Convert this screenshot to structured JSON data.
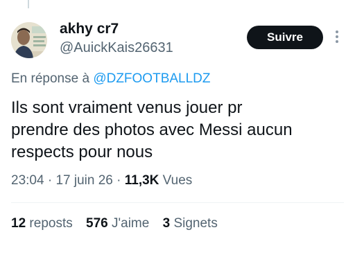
{
  "author": {
    "display_name": "akhy cr7",
    "handle": "@AuickKais26631"
  },
  "follow_button": {
    "label": "Suivre"
  },
  "reply_to": {
    "prefix": "En réponse à",
    "mention": "@DZFOOTBALLDZ"
  },
  "tweet": {
    "lines": [
      "Ils sont vraiment venus jouer pr",
      "prendre des photos avec Messi aucun",
      "respects pour nous"
    ]
  },
  "meta": {
    "time": "23:04",
    "separator": "·",
    "date": "17 juin 26",
    "views_count": "11,3K",
    "views_label": "Vues"
  },
  "stats": {
    "reposts_count": "12",
    "reposts_label": "reposts",
    "likes_count": "576",
    "likes_label": "J'aime",
    "bookmarks_count": "3",
    "bookmarks_label": "Signets"
  },
  "icons": {
    "more": "more-options-icon",
    "avatar": "profile-photo"
  },
  "colors": {
    "link": "#1d9bf0",
    "secondary_text": "#536471",
    "primary_text": "#0f1419",
    "button_bg": "#0f1419"
  }
}
